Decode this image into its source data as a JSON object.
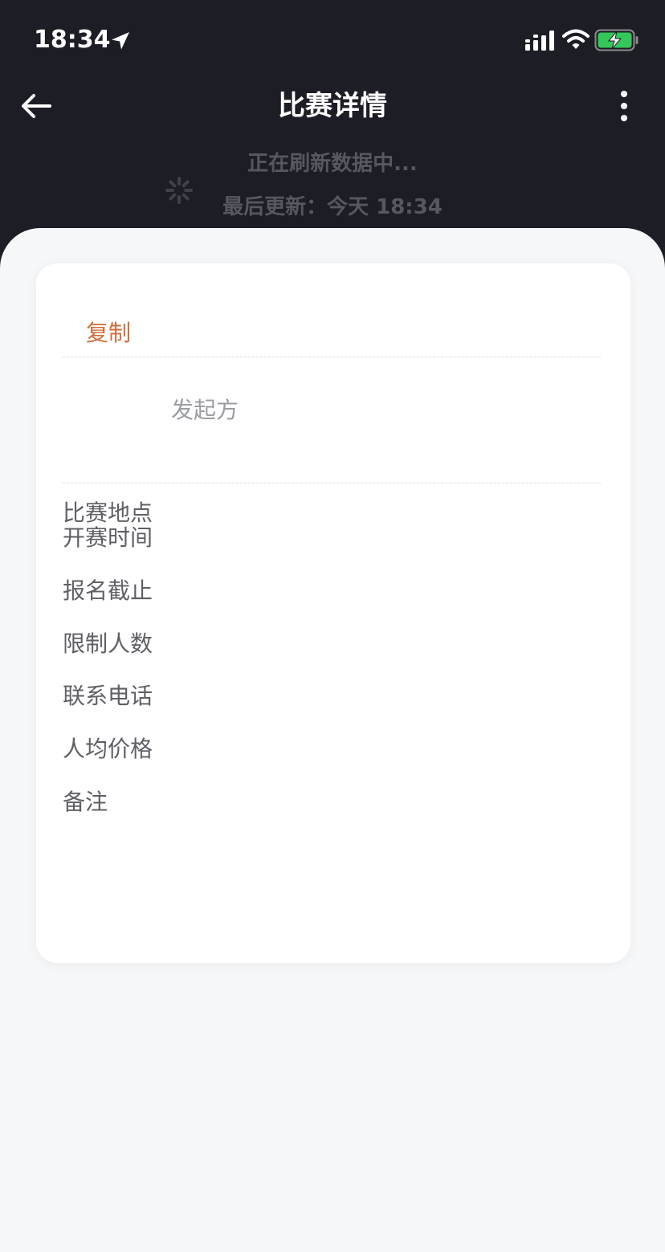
{
  "status_bar": {
    "time": "18:34",
    "icons": [
      "location-arrow-icon",
      "signal-icon",
      "wifi-icon",
      "battery-charging-icon"
    ]
  },
  "nav": {
    "title": "比赛详情",
    "back_icon": "arrow-left-icon",
    "more_icon": "vertical-dots-icon"
  },
  "refresh": {
    "status": "正在刷新数据中...",
    "last_updated": "最后更新：今天 18:34"
  },
  "card": {
    "copy_label": "复制",
    "initiator_label": "发起方",
    "fields": [
      {
        "label": "比赛地点"
      },
      {
        "label": "开赛时间"
      },
      {
        "label": "报名截止"
      },
      {
        "label": "限制人数"
      },
      {
        "label": "联系电话"
      },
      {
        "label": "人均价格"
      },
      {
        "label": "备注"
      }
    ]
  },
  "colors": {
    "nav_background": "#1d1d25",
    "accent": "#d26d3b",
    "sheet_background": "#f6f7f8",
    "card_background": "#ffffff",
    "label_text": "#5f5f66",
    "muted_text": "#9a9ca3",
    "refresh_text": "#575761"
  }
}
